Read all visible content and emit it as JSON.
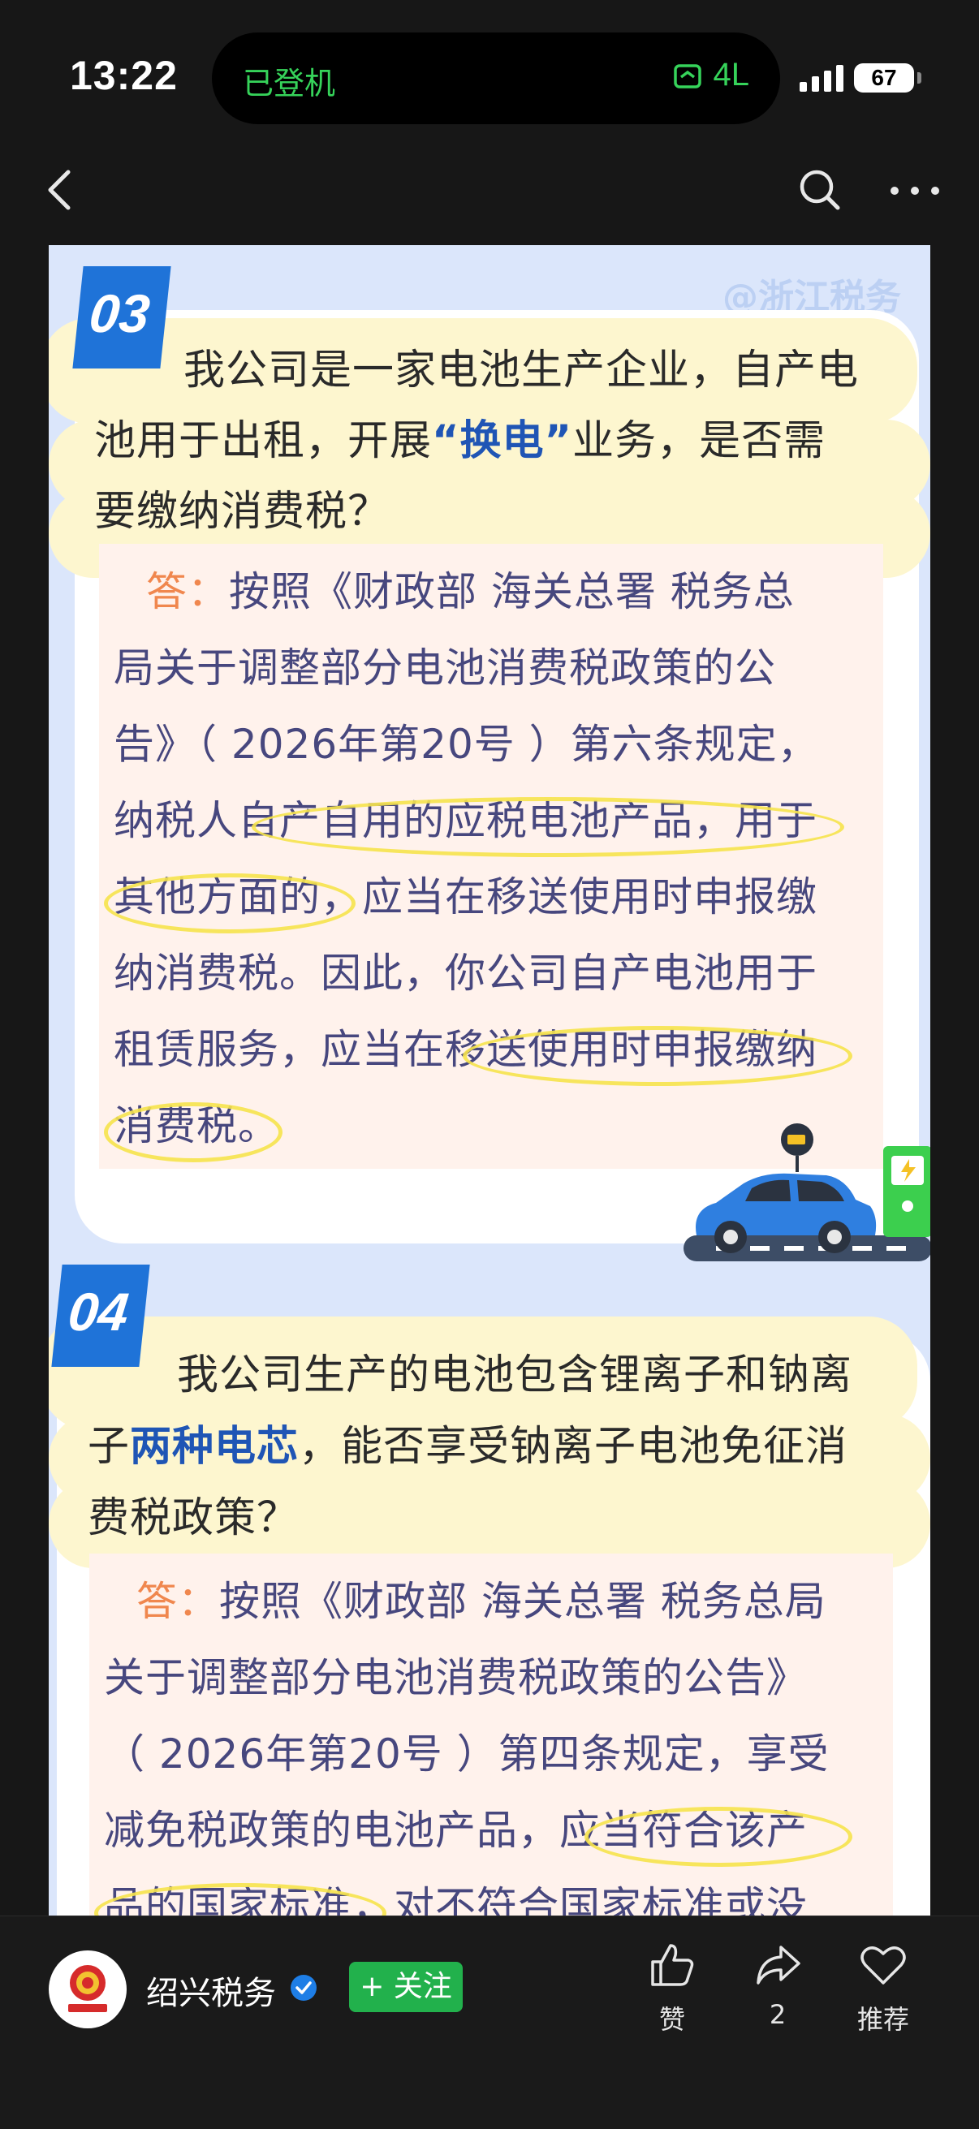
{
  "status_bar": {
    "time": "13:22",
    "island_left": "已登机",
    "island_right": "4L",
    "battery": "67"
  },
  "article": {
    "watermark": "@浙江税务",
    "q3": {
      "number": "03",
      "lines": [
        "我公司是一家电池生产企业，自产电",
        "池用于出租，开展",
        "“换电”",
        "业务，是否需",
        "要缴纳消费税？"
      ],
      "answer_label": "答：",
      "answer_lines": [
        "按照《财政部 海关总署 税务总",
        "局关于调整部分电池消费税政策的公",
        "告》（ 2026年第20号 ）第六条规定，",
        "纳税人自产自用的应税电池产品，用于",
        "其他方面的，应当在移送使用时申报缴",
        "纳消费税。因此，你公司自产电池用于",
        "租赁服务，应当在移送使用时申报缴纳",
        "消费税。"
      ]
    },
    "q4": {
      "number": "04",
      "lines": [
        "我公司生产的电池包含锂离子和钠离",
        "子",
        "两种电芯",
        "，能否享受钠离子电池免征消",
        "费税政策？"
      ],
      "answer_label": "答：",
      "answer_lines": [
        "按照《财政部 海关总署 税务总局",
        "关于调整部分电池消费税政策的公告》",
        "（ 2026年第20号 ）第四条规定，享受",
        "减免税政策的电池产品，应当符合该产",
        "品的国家标准，对不符合国家标准或没"
      ]
    }
  },
  "bottom_bar": {
    "account_name": "绍兴税务",
    "follow_label": "+ 关注",
    "like_label": "赞",
    "share_count": "2",
    "recommend_label": "推荐"
  },
  "colors": {
    "badge": "#1f73d8",
    "follow": "#22b14c",
    "answer_label": "#f0874e"
  }
}
